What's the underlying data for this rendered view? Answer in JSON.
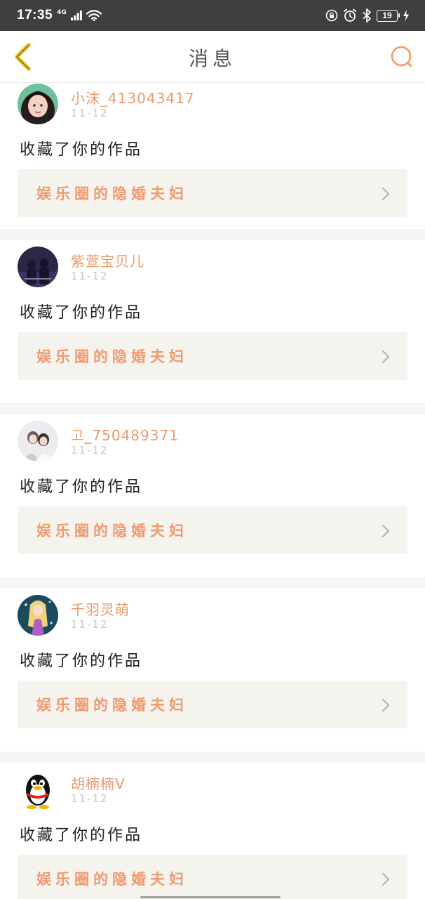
{
  "status_bar": {
    "time": "17:35",
    "network": "4G",
    "battery": "19"
  },
  "nav": {
    "title": "消息",
    "back_icon": "chevron-left-icon",
    "search_icon": "search-icon"
  },
  "messages": [
    {
      "user": "小沫_413043417",
      "date": "11-12",
      "action": "收藏了你的作品",
      "work": "娱乐圈的隐婚夫妇",
      "avatar": "avatar-girl-photo"
    },
    {
      "user": "紫萱宝贝儿",
      "date": "11-12",
      "action": "收藏了你的作品",
      "work": "娱乐圈的隐婚夫妇",
      "avatar": "avatar-couple-dark"
    },
    {
      "user": "고_750489371",
      "date": "11-12",
      "action": "收藏了你的作品",
      "work": "娱乐圈的隐婚夫妇",
      "avatar": "avatar-couple-light"
    },
    {
      "user": "千羽灵萌",
      "date": "11-12",
      "action": "收藏了你的作品",
      "work": "娱乐圈的隐婚夫妇",
      "avatar": "avatar-anime-girl"
    },
    {
      "user": "胡楠楠V",
      "date": "11-12",
      "action": "收藏了你的作品",
      "work": "娱乐圈的隐婚夫妇",
      "avatar": "qq-penguin-avatar"
    }
  ],
  "colors": {
    "accent": "#f09a72",
    "username": "#e99a6b",
    "status_bar_bg": "#3f3f3f",
    "work_box_bg": "#f4f3ed"
  }
}
